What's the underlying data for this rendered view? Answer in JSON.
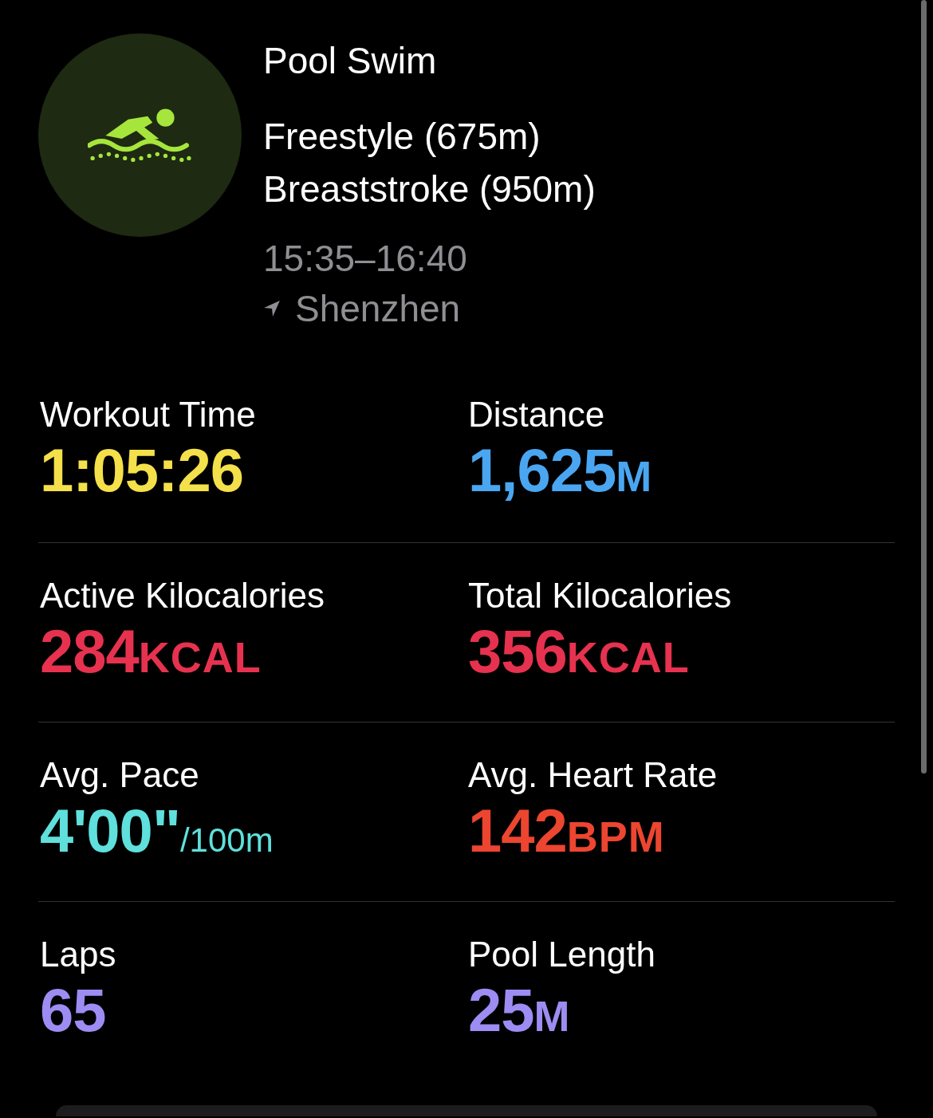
{
  "workout": {
    "title": "Pool Swim",
    "strokes": [
      "Freestyle (675m)",
      "Breaststroke (950m)"
    ],
    "time_range": "15:35–16:40",
    "location": "Shenzhen"
  },
  "metrics": [
    {
      "label": "Workout Time",
      "value": "1:05:26",
      "kind": "bold",
      "color": "#f4e04a"
    },
    {
      "label": "Distance",
      "value": "1,625",
      "unit": "M",
      "kind": "bold",
      "color": "#4aa6f0"
    },
    {
      "label": "Active Kilocalories",
      "value": "284",
      "unit": "KCAL",
      "kind": "bold",
      "color": "#e6324f"
    },
    {
      "label": "Total Kilocalories",
      "value": "356",
      "unit": "KCAL",
      "kind": "bold",
      "color": "#e6324f"
    },
    {
      "label": "Avg. Pace",
      "value": "4'00\"",
      "unit": "/100m",
      "kind": "plain",
      "color": "#5fe0dc"
    },
    {
      "label": "Avg. Heart Rate",
      "value": "142",
      "unit": "BPM",
      "kind": "bold",
      "color": "#ec4530"
    },
    {
      "label": "Laps",
      "value": "65",
      "kind": "bold",
      "color": "#9d8cf2"
    },
    {
      "label": "Pool Length",
      "value": "25",
      "unit": "M",
      "kind": "bold",
      "color": "#9d8cf2"
    }
  ]
}
